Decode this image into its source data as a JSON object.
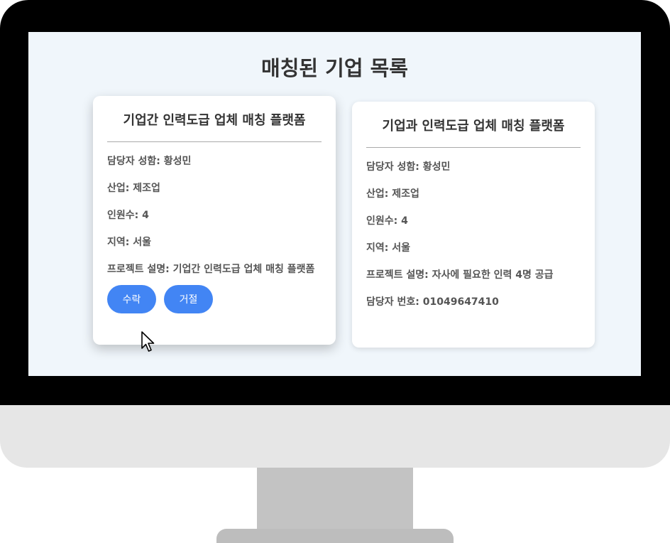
{
  "page": {
    "title": "매칭된 기업 목록"
  },
  "cards": [
    {
      "title": "기업간 인력도급 업체 매칭 플랫폼",
      "manager": "담당자 성함: 황성민",
      "industry": "산업: 제조업",
      "headcount": "인원수: 4",
      "region": "지역: 서울",
      "description": "프로젝트 설명: 기업간 인력도급 업체 매칭 플랫폼",
      "accept_label": "수락",
      "reject_label": "거절"
    },
    {
      "title": "기업과 인력도급 업체 매칭 플랫폼",
      "manager": "담당자 성함: 황성민",
      "industry": "산업: 제조업",
      "headcount": "인원수: 4",
      "region": "지역: 서울",
      "description": "프로젝트 설명: 자사에 필요한 인력 4명 공급",
      "phone": "담당자 번호: 01049647410"
    }
  ],
  "colors": {
    "button": "#4285f4",
    "screen_bg": "#f0f6fb"
  },
  "icons": {
    "cursor": "mouse-pointer-icon"
  }
}
